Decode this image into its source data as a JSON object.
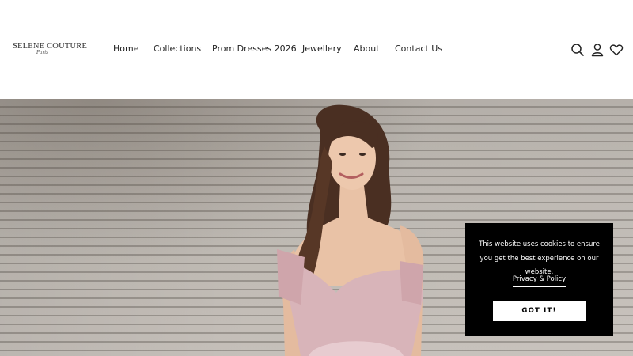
{
  "brand": {
    "name": "SELENE COUTURE",
    "tagline": "Paris"
  },
  "nav": {
    "items": [
      {
        "label": "Home"
      },
      {
        "label": "Collections"
      },
      {
        "label": "Prom Dresses 2026"
      },
      {
        "label": "Jewellery"
      },
      {
        "label": "About"
      },
      {
        "label": "Contact Us"
      }
    ]
  },
  "header_icons": [
    "search-icon",
    "account-icon",
    "wishlist-heart-icon"
  ],
  "hero": {
    "image": "woman-in-pink-off-shoulder-gown-on-stone-steps"
  },
  "cookie": {
    "message": "This website uses cookies to ensure you get the best experience on our website.",
    "link_label": "Privacy & Policy",
    "button_label": "GOT IT!"
  },
  "colors": {
    "text": "#222222",
    "popup_bg": "#000000",
    "popup_text": "#ffffff",
    "dress_pink": "#d8b4b9"
  }
}
